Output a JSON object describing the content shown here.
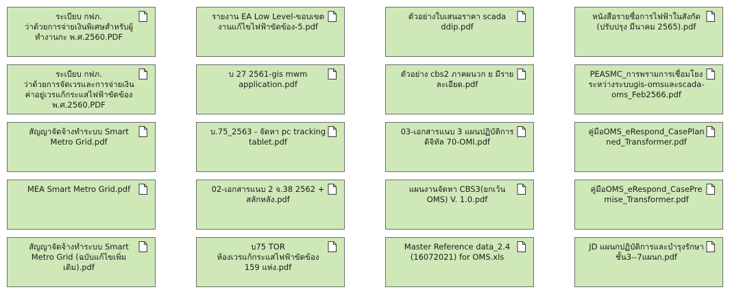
{
  "files": [
    {
      "name": "ระเบียบ กฟภ.\nว่าด้วยการจ่ายเงินพิเศษสำหรับผู้ทำงานกะ พ.ศ.2560.PDF"
    },
    {
      "name": "รายงาน EA Low Level-ขอบเขตงานแก้ไขไฟฟ้าขัดข้อง-5.pdf"
    },
    {
      "name": "ตัวอย่างใบเสนอราคา scada ddip.pdf"
    },
    {
      "name": "หนังสือรายชื่อการไฟฟ้าในสังกัด (ปรับปรุง มีนาคม 2565).pdf"
    },
    {
      "name": "ระเบียบ กฟภ.\nว่าด้วยการจัดเวรและการจ่ายเงินค่าอยู่เวรแก้กระแสไฟฟ้าขัดข้อง พ.ศ.2560.PDF"
    },
    {
      "name": "บ 27 2561-gis mwm application.pdf"
    },
    {
      "name": "ตัวอย่าง cbs2 ภาคผนวก ย มีรายละเอียด.pdf"
    },
    {
      "name": "PEASMC_การพรามการเชื่อมโยงระหว่างระบบgis-omsและscada-oms_Feb2566.pdf"
    },
    {
      "name": "สัญญาจัดจ้างทำระบบ Smart Metro Grid.pdf"
    },
    {
      "name": "บ.75_2563 - จัดหา pc tracking tablet.pdf"
    },
    {
      "name": "03-เอกสารแนบ 3 แผนปฏิบัติการดิจิทัล 70-OMI.pdf"
    },
    {
      "name": "คู่มือOMS_eRespond_CasePlanned_Transformer.pdf"
    },
    {
      "name": "MEA Smart Metro Grid.pdf"
    },
    {
      "name": "02-เอกสารแนบ 2 จ.38 2562 + สลักหลัง.pdf"
    },
    {
      "name": "แผนงานจัดหา CBS3(ยกเว้น OMS) V. 1.0.pdf"
    },
    {
      "name": "คู่มือOMS_eRespond_CasePremise_Transformer.pdf"
    },
    {
      "name": "สัญญาจัดจ้างทำระบบ Smart Metro Grid (ฉบับแก้ไขเพิ่มเติม).pdf"
    },
    {
      "name": "บ75 TOR\nห้องเวรแก้กระแสไฟฟ้าขัดข้อง 159 แห่ง.pdf"
    },
    {
      "name": "Master Reference data_2.4 (16072021) for OMS.xls"
    },
    {
      "name": "JD แผนกปฏิบัติการและบำรุงรักษา ชั้น3--7แผนก.pdf"
    }
  ],
  "colors": {
    "tile_bg": "#cfe8b8",
    "tile_border": "#6c6c6c",
    "text": "#1a1a1a"
  },
  "icon": "document-icon"
}
